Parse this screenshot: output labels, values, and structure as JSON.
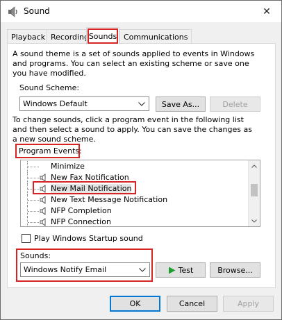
{
  "window": {
    "title": "Sound",
    "close_glyph": "✕",
    "icon": "speaker-app-icon"
  },
  "tabs": [
    {
      "label": "Playback",
      "active": false
    },
    {
      "label": "Recording",
      "active": false
    },
    {
      "label": "Sounds",
      "active": true
    },
    {
      "label": "Communications",
      "active": false
    }
  ],
  "sounds_tab": {
    "theme_description": "A sound theme is a set of sounds applied to events in Windows and programs.  You can select an existing scheme or save one you have modified.",
    "scheme_label": "Sound Scheme:",
    "scheme_value": "Windows Default",
    "save_as_label": "Save As...",
    "delete_label": "Delete",
    "change_description": "To change sounds, click a program event in the following list and then select a sound to apply.  You can save the changes as a new sound scheme.",
    "program_events_label": "Program Events:",
    "events": [
      {
        "label": "Minimize",
        "has_sound": false
      },
      {
        "label": "New Fax Notification",
        "has_sound": true
      },
      {
        "label": "New Mail Notification",
        "has_sound": true,
        "selected": true
      },
      {
        "label": "New Text Message Notification",
        "has_sound": true
      },
      {
        "label": "NFP Completion",
        "has_sound": true
      },
      {
        "label": "NFP Connection",
        "has_sound": true
      }
    ],
    "startup_sound_label": "Play Windows Startup sound",
    "startup_sound_checked": false,
    "sounds_label": "Sounds:",
    "sound_value": "Windows Notify Email",
    "test_label": "Test",
    "browse_label": "Browse..."
  },
  "footer": {
    "ok_label": "OK",
    "cancel_label": "Cancel",
    "apply_label": "Apply"
  },
  "colors": {
    "highlight": "#d42424",
    "accent": "#0078d7",
    "play_green": "#1c9e2c"
  }
}
